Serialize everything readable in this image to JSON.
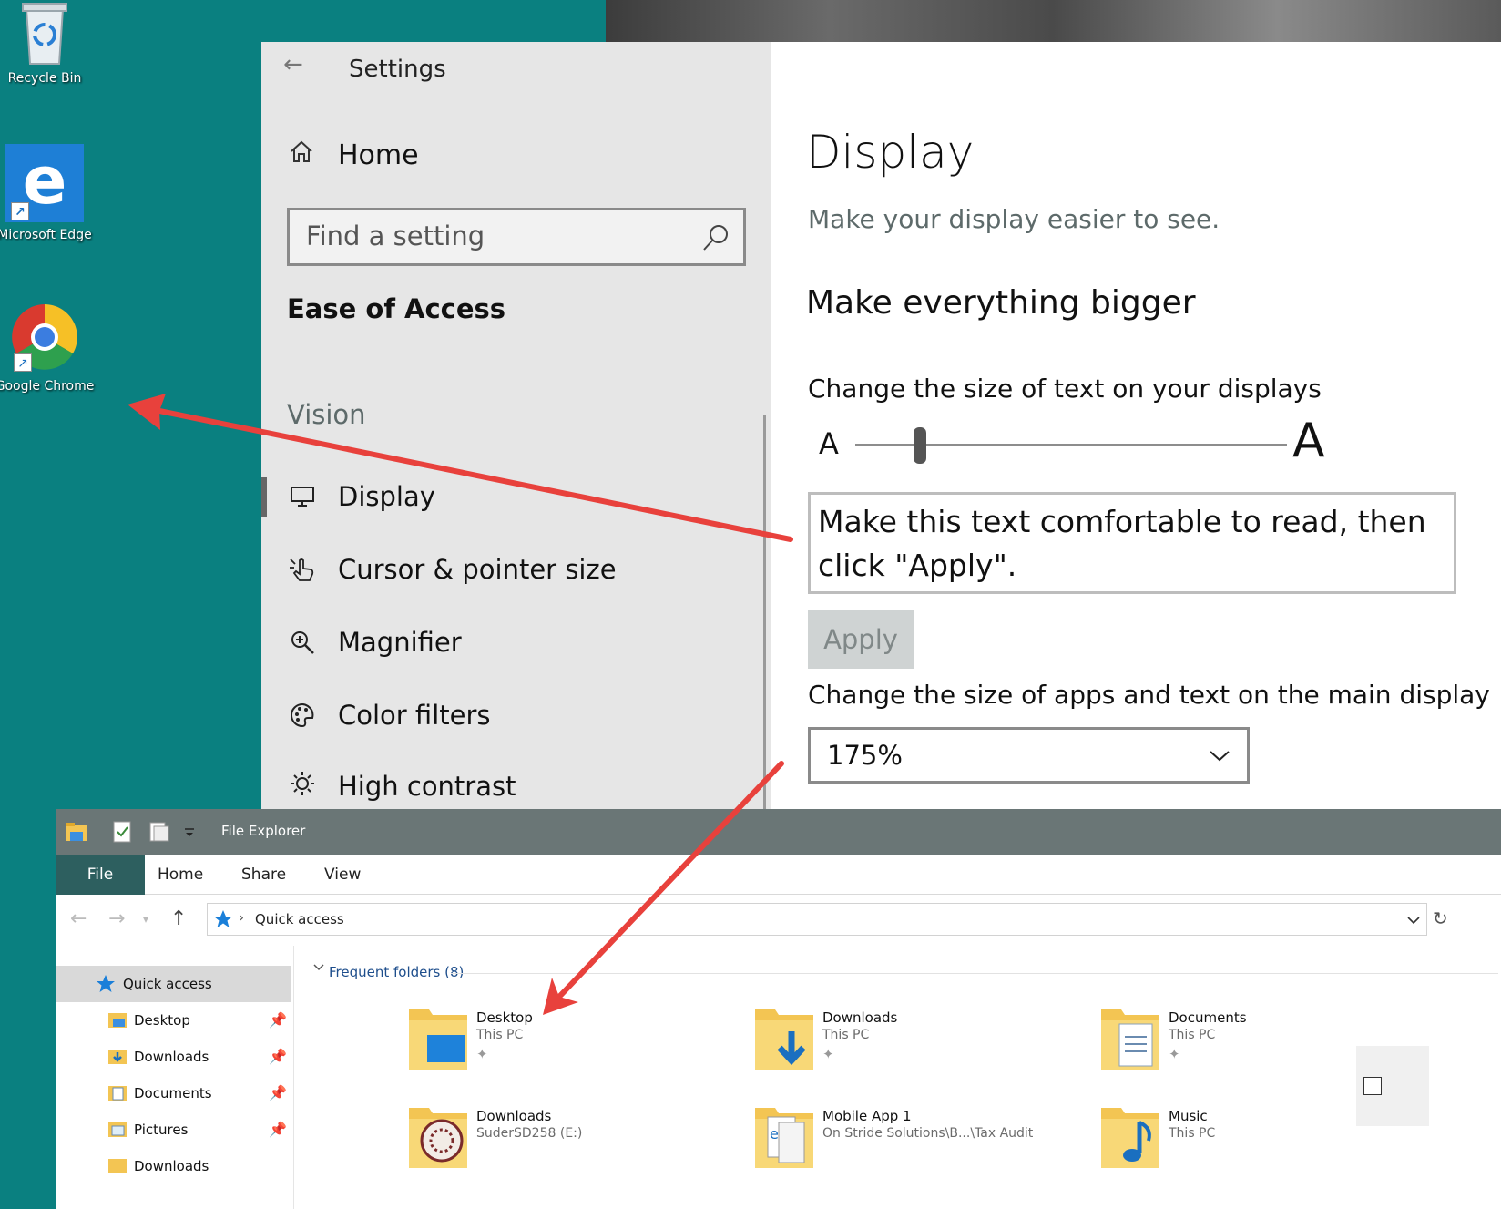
{
  "desktop": {
    "icons": [
      {
        "label": "Recycle Bin",
        "icon": "recycle-bin-icon"
      },
      {
        "label": "Microsoft Edge",
        "icon": "edge-icon"
      },
      {
        "label": "Google Chrome",
        "icon": "chrome-icon"
      }
    ]
  },
  "settings": {
    "title": "Settings",
    "home_label": "Home",
    "search_placeholder": "Find a setting",
    "section_title": "Ease of Access",
    "group_label": "Vision",
    "nav_items": [
      {
        "label": "Display",
        "icon": "monitor-icon",
        "selected": true
      },
      {
        "label": "Cursor & pointer size",
        "icon": "cursor-icon"
      },
      {
        "label": "Magnifier",
        "icon": "magnifier-icon"
      },
      {
        "label": "Color filters",
        "icon": "palette-icon"
      },
      {
        "label": "High contrast",
        "icon": "sun-icon"
      }
    ],
    "content": {
      "title": "Display",
      "subtitle": "Make your display easier to see.",
      "heading": "Make everything bigger",
      "text_size_label": "Change the size of text on your displays",
      "slider_small": "A",
      "slider_big": "A",
      "text_size_level": 0.15,
      "preview_text": "Make this text comfortable to read, then click \"Apply\".",
      "apply_label": "Apply",
      "scale_label": "Change the size of apps and text on the main display",
      "scale_value": "175%"
    }
  },
  "explorer": {
    "title": "File Explorer",
    "tabs": [
      "File",
      "Home",
      "Share",
      "View"
    ],
    "address": "Quick access",
    "sidebar": {
      "quick_access": "Quick access",
      "items": [
        "Desktop",
        "Downloads",
        "Documents",
        "Pictures",
        "Downloads"
      ]
    },
    "frequent_header": "Frequent folders (8)",
    "folders": [
      {
        "name": "Desktop",
        "location": "This PC",
        "pinned": true
      },
      {
        "name": "Downloads",
        "location": "This PC",
        "pinned": true
      },
      {
        "name": "Documents",
        "location": "This PC",
        "pinned": true
      },
      {
        "name": "Downloads",
        "location": "SuderSD258 (E:)",
        "pinned": false
      },
      {
        "name": "Mobile App 1",
        "location": "On Stride Solutions\\B...\\Tax Audit",
        "pinned": false
      },
      {
        "name": "Music",
        "location": "This PC",
        "pinned": false
      }
    ]
  },
  "colors": {
    "desktop_bg": "#0a8080",
    "annotation_arrow": "#e8413c",
    "explorer_titlebar": "#6a7676",
    "explorer_file_tab": "#2d5f5f"
  }
}
